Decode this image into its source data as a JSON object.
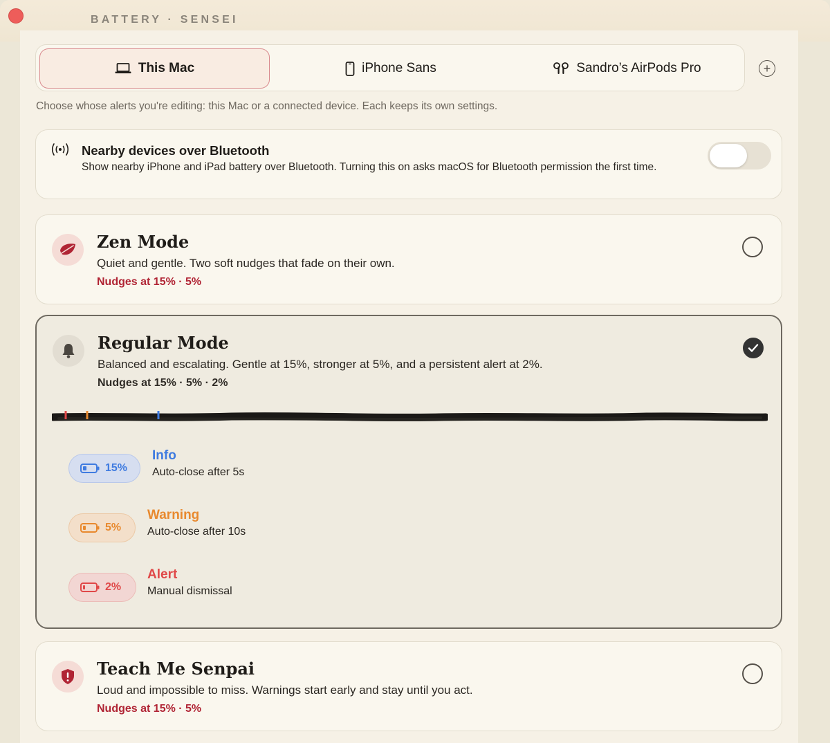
{
  "window": {
    "title": "BATTERY · SENSEI"
  },
  "tabs": [
    {
      "label": "This Mac",
      "icon": "laptop-icon",
      "active": true
    },
    {
      "label": "iPhone Sans",
      "icon": "iphone-icon",
      "active": false
    },
    {
      "label": "Sandro’s AirPods Pro",
      "icon": "airpods-icon",
      "active": false
    }
  ],
  "hint": "Choose whose alerts you're editing: this Mac or a connected device. Each keeps its own settings.",
  "bluetooth": {
    "title": "Nearby devices over Bluetooth",
    "description": "Show nearby iPhone and iPad battery over Bluetooth. Turning this on asks macOS for Bluetooth permission the first time.",
    "enabled": false
  },
  "modes": [
    {
      "id": "zen",
      "title": "Zen Mode",
      "description": "Quiet and gentle. Two soft nudges that fade on their own.",
      "nudges": "Nudges at 15% · 5%",
      "selected": false,
      "icon": "leaf-icon"
    },
    {
      "id": "regular",
      "title": "Regular Mode",
      "description": "Balanced and escalating. Gentle at 15%, stronger at 5%, and a persistent alert at 2%.",
      "nudges": "Nudges at 15% · 5% · 2%",
      "selected": true,
      "icon": "bell-icon",
      "levels": [
        {
          "percent": "15%",
          "name": "Info",
          "detail": "Auto-close after 5s",
          "color": "#3f7be0"
        },
        {
          "percent": "5%",
          "name": "Warning",
          "detail": "Auto-close after 10s",
          "color": "#e8892e"
        },
        {
          "percent": "2%",
          "name": "Alert",
          "detail": "Manual dismissal",
          "color": "#e04848"
        }
      ]
    },
    {
      "id": "senpai",
      "title": "Teach Me Senpai",
      "description": "Loud and impossible to miss. Warnings start early and stay until you act.",
      "nudges": "Nudges at 15% · 5%",
      "selected": false,
      "icon": "shield-alert-icon"
    }
  ],
  "colors": {
    "accent_red": "#b02434",
    "info_blue": "#3f7be0",
    "warning_orange": "#e8892e",
    "alert_red": "#e04848"
  }
}
